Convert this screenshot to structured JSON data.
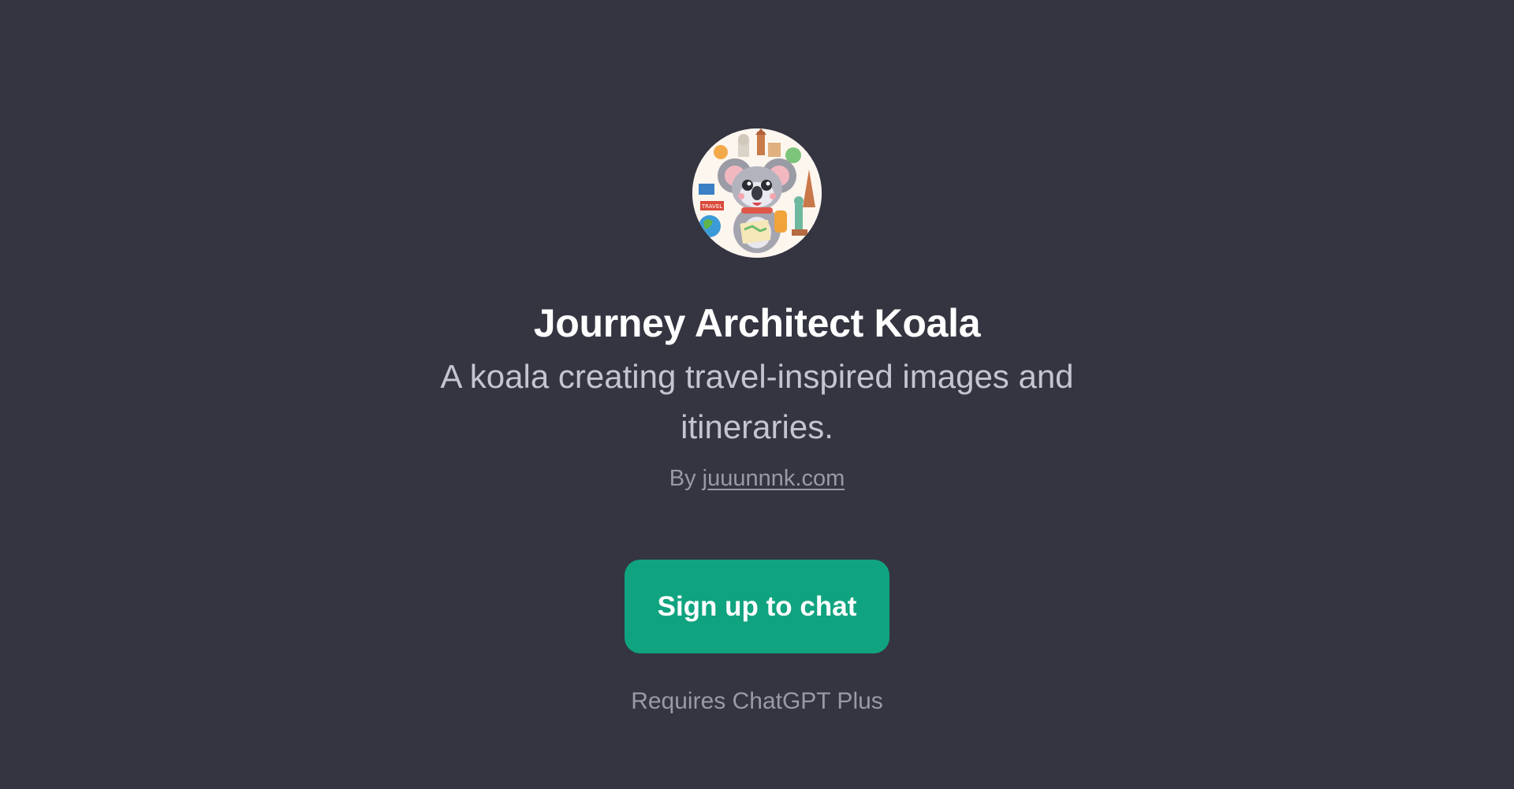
{
  "gpt": {
    "name": "Journey Architect Koala",
    "description": "A koala creating travel-inspired images and itineraries.",
    "by_prefix": "By",
    "author": "juuunnnk.com",
    "avatar_icon": "koala-traveler-avatar"
  },
  "cta": {
    "signup_label": "Sign up to chat",
    "button_color": "#10a37f"
  },
  "requirement": "Requires ChatGPT Plus",
  "colors": {
    "background": "#343541",
    "title": "#ffffff",
    "muted_text": "#9a9aa6"
  }
}
